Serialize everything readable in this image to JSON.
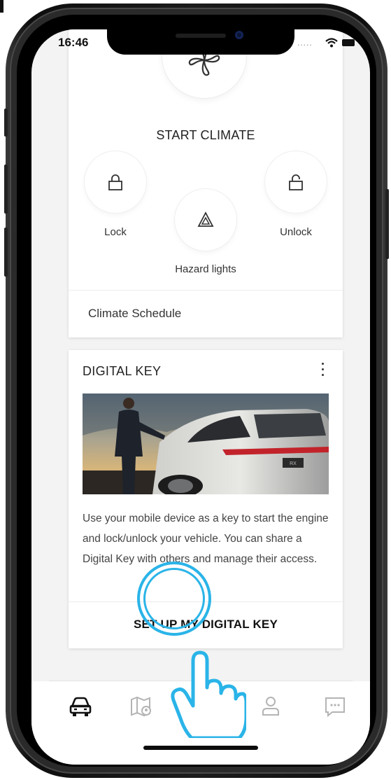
{
  "status_bar": {
    "time": "16:46",
    "signal": "....."
  },
  "remote": {
    "start_climate_label": "START CLIMATE",
    "lock_label": "Lock",
    "unlock_label": "Unlock",
    "hazard_label": "Hazard lights",
    "climate_schedule_label": "Climate Schedule"
  },
  "digital_key": {
    "title": "DIGITAL KEY",
    "description": "Use your mobile device as a key to start the engine and lock/unlock your vehicle. You can share a Digital Key with others and manage their access.",
    "cta_label": "SET UP MY DIGITAL KEY",
    "plate_text": "RX"
  },
  "tabbar": {
    "items": [
      {
        "icon": "car-icon",
        "active": true
      },
      {
        "icon": "map-icon",
        "active": false
      },
      {
        "icon": "profile-icon",
        "active": false
      },
      {
        "icon": "chat-icon",
        "active": false
      }
    ]
  },
  "colors": {
    "accent_touch": "#2ab4e8",
    "card_bg": "#ffffff",
    "screen_bg": "#f3f3f3"
  }
}
